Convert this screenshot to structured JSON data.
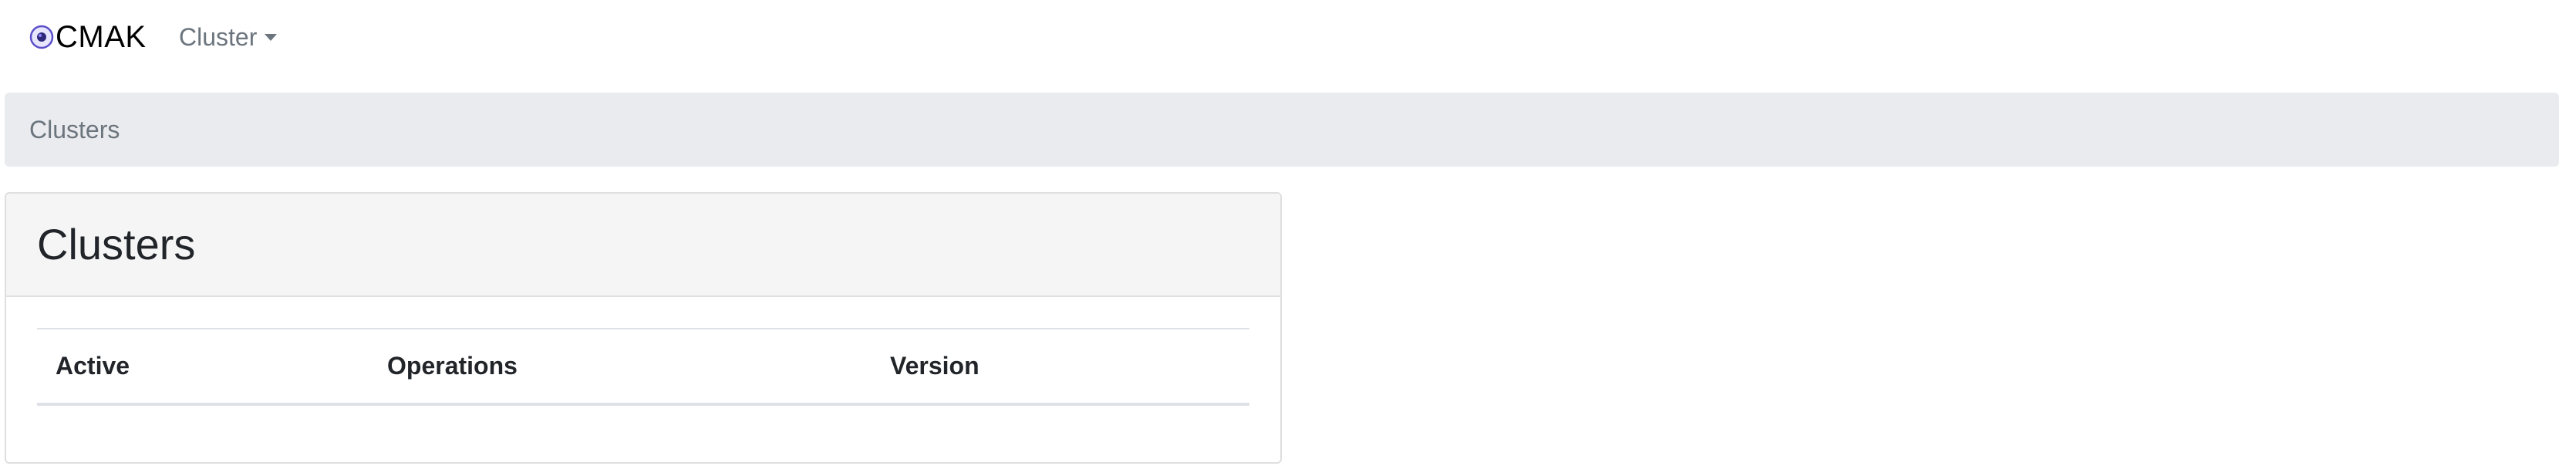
{
  "navbar": {
    "brand": "CMAK",
    "brand_logo_icon": "cmak-logo-icon",
    "dropdown_label": "Cluster"
  },
  "breadcrumb": {
    "items": [
      "Clusters"
    ]
  },
  "card": {
    "title": "Clusters",
    "table": {
      "columns": [
        "Active",
        "Operations",
        "Version"
      ],
      "rows": []
    }
  },
  "colors": {
    "breadcrumb_bg": "#e9ebef",
    "card_header_bg": "#f5f5f5",
    "muted_text": "#6c757d",
    "logo_accent": "#5b4fc9"
  }
}
